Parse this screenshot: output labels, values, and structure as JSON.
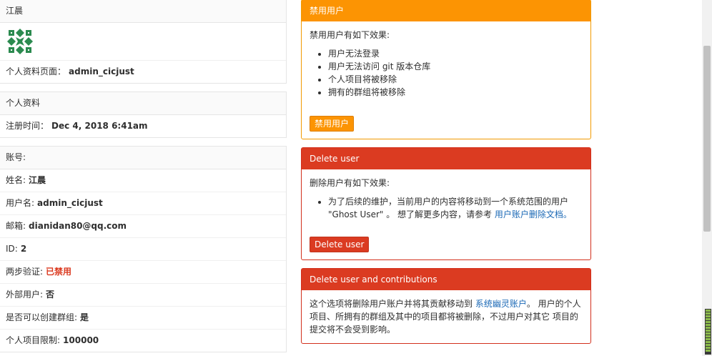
{
  "user": {
    "display_name": "江晨",
    "profile_page_label": "个人资料页面：",
    "profile_page_value": "admin_cicjust"
  },
  "profile": {
    "header": "个人资料",
    "member_since_label": "注册时间：",
    "member_since_value": "Dec 4, 2018 6:41am"
  },
  "account": {
    "header": "账号:",
    "rows": [
      {
        "label": "姓名:",
        "value": "江晨",
        "status": "normal"
      },
      {
        "label": "用户名:",
        "value": "admin_cicjust",
        "status": "normal"
      },
      {
        "label": "邮箱:",
        "value": "dianidan80@qq.com",
        "status": "normal"
      },
      {
        "label": "ID:",
        "value": "2",
        "status": "normal"
      },
      {
        "label": "两步验证:",
        "value": "已禁用",
        "status": "danger"
      },
      {
        "label": "外部用户:",
        "value": "否",
        "status": "normal"
      },
      {
        "label": "是否可以创建群组:",
        "value": "是",
        "status": "normal"
      },
      {
        "label": "个人项目限制:",
        "value": "100000",
        "status": "normal"
      }
    ]
  },
  "block_panel": {
    "title": "禁用用户",
    "intro": "禁用用户有如下效果:",
    "effects": [
      "用户无法登录",
      "用户无法访问 git 版本仓库",
      "个人项目将被移除",
      "拥有的群组将被移除"
    ],
    "button_label": "禁用用户"
  },
  "delete_panel": {
    "title": "Delete user",
    "intro": "删除用户有如下效果:",
    "effect_text": "为了后续的维护，当前用户的内容将移动到一个系统范围的用户 \"Ghost User\" 。 想了解更多内容，请参考",
    "effect_link": "用户账户删除文档。",
    "button_label": "Delete user"
  },
  "delete_contrib_panel": {
    "title": "Delete user and contributions",
    "text_before": "这个选项将删除用户账户并将其贡献移动到",
    "link": "系统幽灵账户",
    "text_after": "。 用户的个人项目、所拥有的群组及其中的项目都将被删除，不过用户对其它 项目的提交将不会受到影响。"
  },
  "colors": {
    "warning": "#fc9403",
    "danger": "#db3b21",
    "link": "#1b69b6",
    "identicon": "#2b8a4f"
  }
}
